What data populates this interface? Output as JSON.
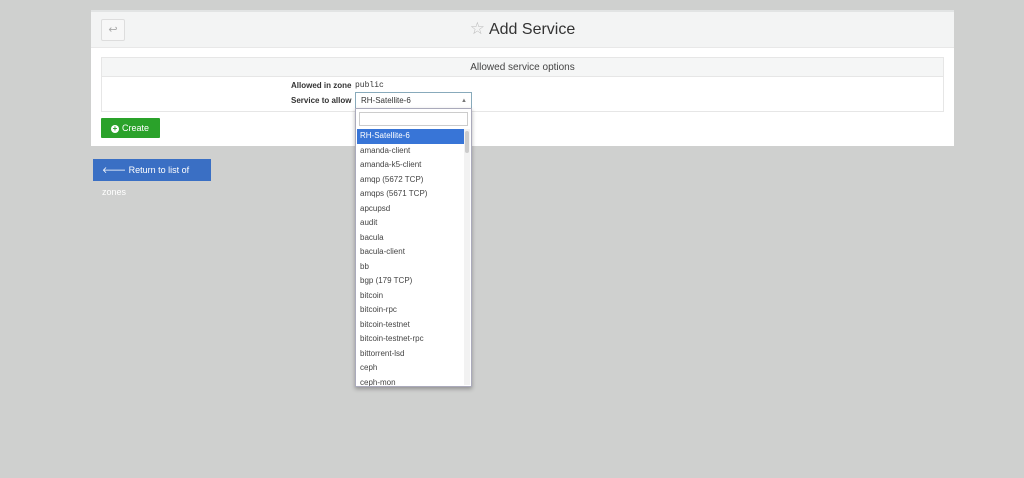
{
  "header": {
    "title": "Add Service",
    "back_icon": "return-arrow-icon",
    "star_icon": "star-icon"
  },
  "section": {
    "title": "Allowed service options",
    "zone_label": "Allowed in zone",
    "zone_value": "public",
    "service_label": "Service to allow",
    "service_value": "RH-Satellite-6"
  },
  "buttons": {
    "create": "Create",
    "return": "Return to list of zones"
  },
  "dropdown": {
    "search_value": "",
    "items": [
      "RH-Satellite-6",
      "amanda-client",
      "amanda-k5-client",
      "amqp (5672 TCP)",
      "amqps (5671 TCP)",
      "apcupsd",
      "audit",
      "bacula",
      "bacula-client",
      "bb",
      "bgp (179 TCP)",
      "bitcoin",
      "bitcoin-rpc",
      "bitcoin-testnet",
      "bitcoin-testnet-rpc",
      "bittorrent-lsd",
      "ceph",
      "ceph-mon"
    ],
    "selected_index": 0
  },
  "colors": {
    "create": "#2aa22a",
    "return": "#3a6fc4",
    "highlight": "#3875d7"
  }
}
